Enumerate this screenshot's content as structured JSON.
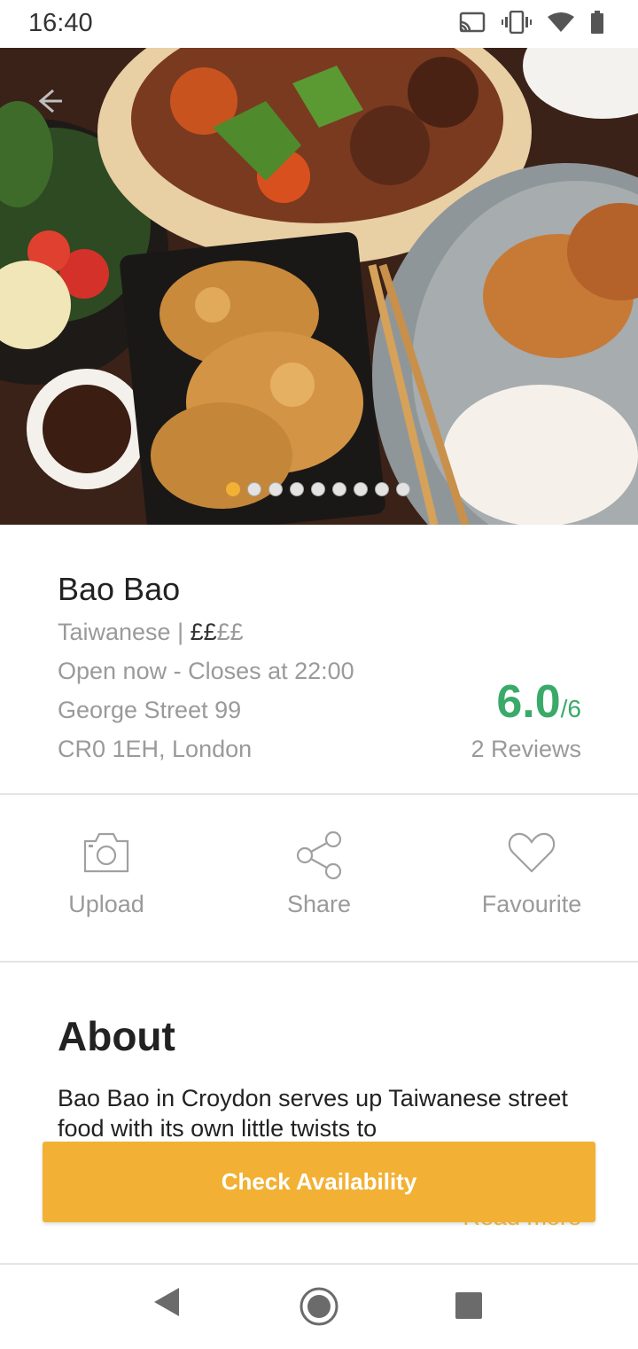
{
  "status_bar": {
    "time": "16:40"
  },
  "hero": {
    "image_description": "",
    "carousel": {
      "count": 9,
      "active_index": 0
    }
  },
  "restaurant": {
    "name": "Bao Bao",
    "cuisine": "Taiwanese",
    "separator": " | ",
    "price_active": "££",
    "price_inactive": "££",
    "hours": "Open now - Closes at 22:00",
    "address_line1": "George Street 99",
    "address_line2": "CR0 1EH, London",
    "rating": "6.0",
    "rating_out_of": "/6",
    "reviews": "2 Reviews"
  },
  "actions": {
    "upload": "Upload",
    "share": "Share",
    "favourite": "Favourite"
  },
  "about": {
    "title": "About",
    "text": "Bao Bao in Croydon serves up Taiwanese street food with its own little twists to",
    "read_more": "Read more"
  },
  "cta": {
    "label": "Check Availability"
  },
  "colors": {
    "accent": "#f2b134",
    "rating_green": "#3aaa6a"
  }
}
